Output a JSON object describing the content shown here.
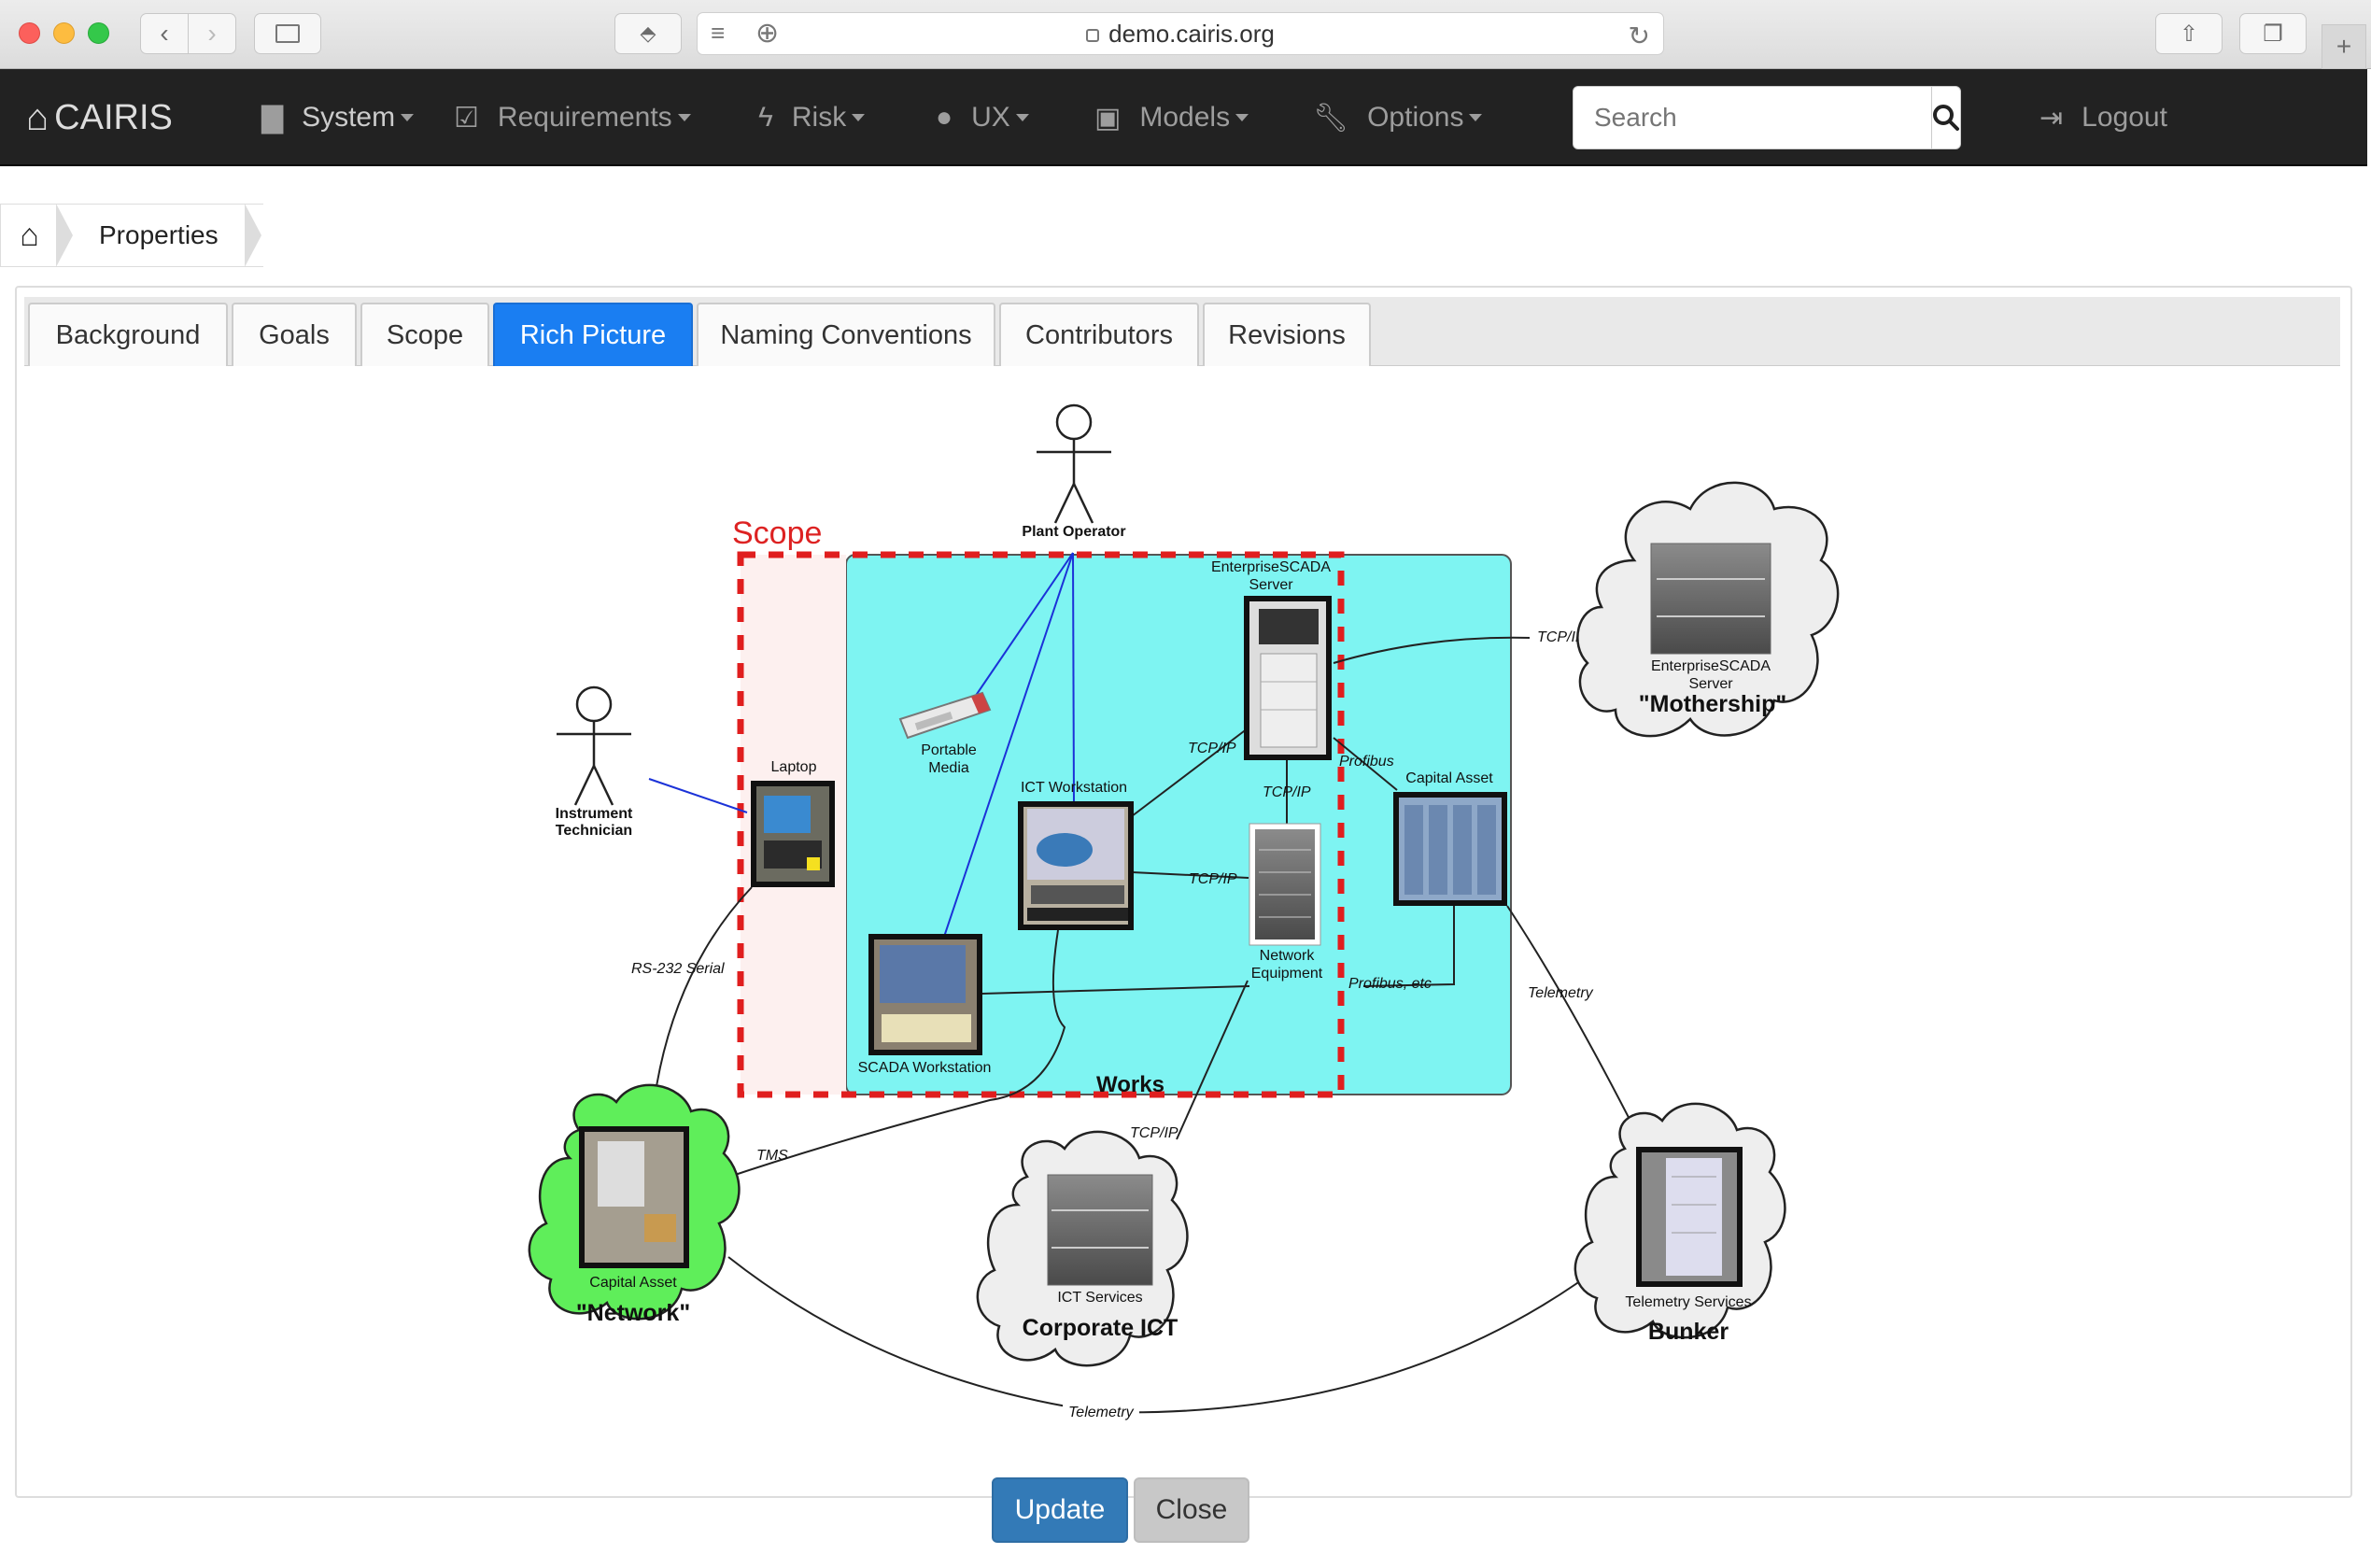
{
  "browser": {
    "url": "demo.cairis.org"
  },
  "navbar": {
    "brand": "CAIRIS",
    "items": [
      {
        "label": "System",
        "icon": "book-icon"
      },
      {
        "label": "Requirements",
        "icon": "checkbox-icon"
      },
      {
        "label": "Risk",
        "icon": "bolt-icon"
      },
      {
        "label": "UX",
        "icon": "user-icon"
      },
      {
        "label": "Models",
        "icon": "picture-icon"
      },
      {
        "label": "Options",
        "icon": "wrench-icon"
      }
    ],
    "search_placeholder": "Search",
    "logout": "Logout"
  },
  "breadcrumb": {
    "current": "Properties"
  },
  "tabs": [
    "Background",
    "Goals",
    "Scope",
    "Rich Picture",
    "Naming Conventions",
    "Contributors",
    "Revisions"
  ],
  "active_tab": "Rich Picture",
  "picture": {
    "scope_label": "Scope",
    "works_label": "Works",
    "actors": {
      "plant_operator": "Plant Operator",
      "instrument_technician_1": "Instrument",
      "instrument_technician_2": "Technician"
    },
    "nodes": {
      "enterprise_scada_server_1": "EnterpriseSCADA",
      "enterprise_scada_server_2": "Server",
      "portable_media_1": "Portable",
      "portable_media_2": "Media",
      "laptop": "Laptop",
      "ict_workstation": "ICT Workstation",
      "capital_asset": "Capital Asset",
      "network_equipment_1": "Network",
      "network_equipment_2": "Equipment",
      "scada_workstation": "SCADA Workstation"
    },
    "clouds": {
      "mothership_sub1": "EnterpriseSCADA",
      "mothership_sub2": "Server",
      "mothership_title": "\"Mothership\"",
      "network_sub": "Capital Asset",
      "network_title": "\"Network\"",
      "ict_sub": "ICT Services",
      "ict_title": "Corporate ICT",
      "bunker_sub": "Telemetry Services",
      "bunker_title": "Bunker"
    },
    "links": {
      "tcpip_mothership": "TCP/IP",
      "tcpip_ict": "TCP/IP",
      "tcpip_vertical": "TCP/IP",
      "tcpip_netequip": "TCP/IP",
      "tcpip_corp": "TCP/IP",
      "profibus": "Profibus",
      "profibus_etc": "Profibus, etc",
      "rs232": "RS-232 Serial",
      "telemetry_right": "Telemetry",
      "tms": "TMS",
      "telemetry_bottom": "Telemetry"
    }
  },
  "buttons": {
    "update": "Update",
    "close": "Close"
  }
}
